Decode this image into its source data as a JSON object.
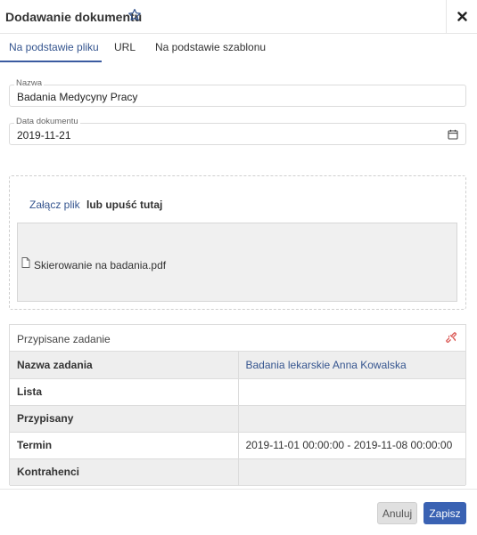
{
  "dialog": {
    "title": "Dodawanie dokumentu"
  },
  "tabs": [
    {
      "label": "Na podstawie pliku",
      "active": true
    },
    {
      "label": "URL",
      "active": false
    },
    {
      "label": "Na podstawie szablonu",
      "active": false
    }
  ],
  "form": {
    "name": {
      "label": "Nazwa",
      "value": "Badania Medycyny Pracy"
    },
    "date": {
      "label": "Data dokumentu",
      "value": "2019-11-21"
    }
  },
  "upload": {
    "attach_link": "Załącz plik",
    "drop_text": "lub upuść tutaj",
    "file_name": "Skierowanie na badania.pdf"
  },
  "task": {
    "header": "Przypisane zadanie",
    "rows": [
      {
        "key": "Nazwa zadania",
        "value": "Badania lekarskie Anna Kowalska"
      },
      {
        "key": "Lista",
        "value": ""
      },
      {
        "key": "Przypisany",
        "value": ""
      },
      {
        "key": "Termin",
        "value": "2019-11-01 00:00:00 - 2019-11-08 00:00:00"
      },
      {
        "key": "Kontrahenci",
        "value": ""
      }
    ]
  },
  "footer": {
    "cancel_label": "Anuluj",
    "save_label": "Zapisz"
  },
  "colors": {
    "accent": "#35558f",
    "primary_button": "#3a62b3",
    "unlink_icon": "#d9534f"
  },
  "icons": {
    "favorite": "star-outline-icon",
    "close": "close-icon",
    "calendar": "calendar-icon",
    "file": "file-icon",
    "unlink": "unlink-icon"
  }
}
